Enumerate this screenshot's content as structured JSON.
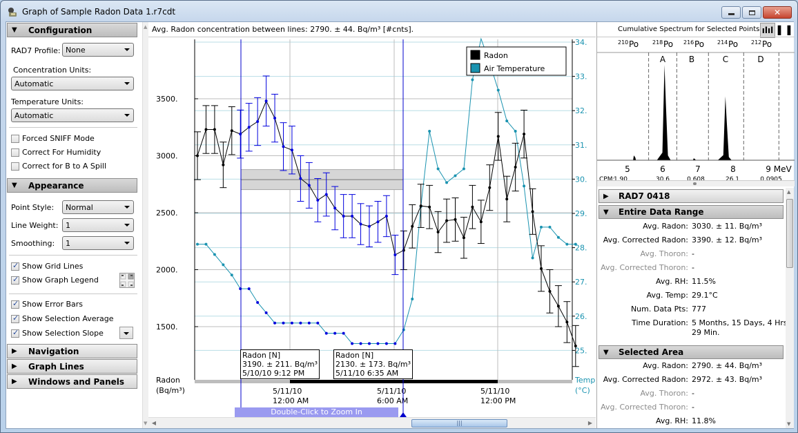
{
  "window": {
    "title": "Graph of Sample Radon Data 1.r7cdt",
    "minimize_label": "minimize",
    "maximize_label": "maximize",
    "close_label": "close"
  },
  "left_panel": {
    "configuration": {
      "header": "Configuration",
      "rad7_profile_label": "RAD7 Profile:",
      "rad7_profile_value": "None",
      "concentration_units_label": "Concentration Units:",
      "concentration_units_value": "Automatic",
      "temperature_units_label": "Temperature Units:",
      "temperature_units_value": "Automatic",
      "checkboxes": [
        {
          "label": "Forced SNIFF Mode",
          "checked": false
        },
        {
          "label": "Correct For Humidity",
          "checked": false
        },
        {
          "label": "Correct for B to A Spill",
          "checked": false
        }
      ]
    },
    "appearance": {
      "header": "Appearance",
      "point_style_label": "Point Style:",
      "point_style_value": "Normal",
      "line_weight_label": "Line Weight:",
      "line_weight_value": "1",
      "smoothing_label": "Smoothing:",
      "smoothing_value": "1",
      "checkboxes": [
        {
          "label": "Show Grid Lines",
          "checked": true
        },
        {
          "label": "Show Graph Legend",
          "checked": true
        },
        {
          "label": "Show Error Bars",
          "checked": true
        },
        {
          "label": "Show Selection Average",
          "checked": true
        },
        {
          "label": "Show Selection Slope",
          "checked": true
        }
      ]
    },
    "collapsed_sections": [
      "Navigation",
      "Graph Lines",
      "Windows and Panels"
    ]
  },
  "center": {
    "info_line": "Avg. Radon concentration between lines: 2790. ± 44. Bq/m³ [#cnts].",
    "zoom_hint": "Double-Click to Zoom In",
    "tooltips": [
      {
        "line1": "Radon [N]",
        "line2": "3190. ± 211. Bq/m³",
        "line3": "5/10/10 9:12 PM"
      },
      {
        "line1": "Radon [N]",
        "line2": "2130. ± 173. Bq/m³",
        "line3": "5/11/10 6:35 AM"
      }
    ]
  },
  "chart_data": {
    "type": "line",
    "title": "",
    "left_axis": {
      "label_line1": "Radon",
      "label_line2": "(Bq/m³)",
      "ticks": [
        1500,
        2000,
        2500,
        3000,
        3500
      ],
      "tick_labels": [
        "1500.",
        "2000.",
        "2500.",
        "3000.",
        "3500."
      ],
      "range": [
        1050,
        4040
      ]
    },
    "right_axis": {
      "label_line1": "Temp",
      "label_line2": "(°C)",
      "ticks": [
        25,
        26,
        27,
        28,
        29,
        30,
        31,
        32,
        33,
        34
      ],
      "tick_labels": [
        "25.",
        "26.",
        "27.",
        "28.",
        "29.",
        "30.",
        "31.",
        "32.",
        "33.",
        "34."
      ],
      "range": [
        24.1,
        34.1
      ],
      "color": "#1a93b0"
    },
    "x_tick_labels": [
      {
        "line1": "5/11/10",
        "line2": "12:00 AM"
      },
      {
        "line1": "5/11/10",
        "line2": "6:00 AM"
      },
      {
        "line1": "5/11/10",
        "line2": "12:00 PM"
      }
    ],
    "legend": {
      "position": "top-right",
      "entries": [
        {
          "name": "Radon",
          "color": "#000000"
        },
        {
          "name": "Air Temperature",
          "color": "#1a93b0"
        }
      ]
    },
    "selection": {
      "start_index": 5,
      "end_index": 24,
      "average": 2790,
      "average_uncertainty": 44,
      "line_color": "#0000cc"
    },
    "grid": true,
    "series": [
      {
        "name": "Radon",
        "color": "#000000",
        "selected_color": "#0000dd",
        "values": [
          3000,
          3230,
          3230,
          2920,
          3220,
          3190,
          3250,
          3300,
          3480,
          3330,
          3080,
          3050,
          2800,
          2740,
          2610,
          2660,
          2540,
          2470,
          2470,
          2400,
          2380,
          2420,
          2470,
          2130,
          2170,
          2380,
          2560,
          2550,
          2330,
          2430,
          2440,
          2280,
          2550,
          2420,
          2720,
          3170,
          2620,
          2900,
          3190,
          2510,
          2010,
          1810,
          1680,
          1540,
          1330
        ],
        "errors": [
          210,
          210,
          210,
          200,
          210,
          211,
          210,
          210,
          220,
          210,
          210,
          210,
          200,
          200,
          190,
          190,
          190,
          190,
          190,
          180,
          180,
          180,
          180,
          173,
          170,
          190,
          190,
          190,
          180,
          190,
          190,
          180,
          190,
          190,
          200,
          210,
          200,
          210,
          210,
          200,
          200,
          190,
          180,
          180,
          180
        ]
      },
      {
        "name": "Air Temperature",
        "color": "#1a93b0",
        "selected_color": "#0000dd",
        "x_index": [
          0,
          1,
          2,
          3,
          4,
          5,
          6,
          7,
          8,
          9,
          10,
          11,
          12,
          13,
          14,
          15,
          16,
          17,
          18,
          19,
          20,
          21,
          22,
          23,
          24,
          25,
          26,
          27,
          28,
          29,
          30,
          31,
          32,
          33,
          34,
          35,
          36,
          37,
          38,
          39,
          40,
          41,
          42,
          43,
          44
        ],
        "values": [
          28.1,
          28.1,
          27.8,
          27.5,
          27.2,
          26.8,
          26.8,
          26.4,
          26.1,
          25.8,
          25.8,
          25.8,
          25.8,
          25.8,
          25.8,
          25.5,
          25.5,
          25.5,
          25.2,
          25.2,
          25.2,
          25.2,
          25.2,
          25.2,
          25.6,
          26.5,
          29.2,
          31.4,
          30.3,
          29.9,
          30.1,
          30.3,
          32.9,
          34.4,
          33.4,
          32.6,
          31.7,
          31.4,
          29.8,
          27.7,
          28.6,
          28.6,
          28.3,
          28.1,
          28.1
        ]
      }
    ]
  },
  "right_panel": {
    "spectrum_title": "Cumulative Spectrum for Selected Points",
    "isotopes": [
      {
        "mass": "210",
        "symbol": "Po"
      },
      {
        "mass": "218",
        "symbol": "Po"
      },
      {
        "mass": "216",
        "symbol": "Po"
      },
      {
        "mass": "214",
        "symbol": "Po"
      },
      {
        "mass": "212",
        "symbol": "Po"
      }
    ],
    "windows": [
      "A",
      "B",
      "C",
      "D"
    ],
    "energy_ticks": [
      "5",
      "6",
      "7",
      "8",
      "9 MeV"
    ],
    "cpm_label": "CPM:",
    "cpm_values": [
      "1.90",
      "30.6",
      "0.608",
      "26.1",
      "0.0905"
    ],
    "spectrum_peaks": [
      {
        "energy_mev": 5.2,
        "relative_height": 0.05
      },
      {
        "energy_mev": 6.07,
        "relative_height": 1.0
      },
      {
        "energy_mev": 6.9,
        "relative_height": 0.02
      },
      {
        "energy_mev": 7.8,
        "relative_height": 0.67
      }
    ],
    "device_header": "RAD7 0418",
    "entire_range": {
      "header": "Entire Data Range",
      "rows": [
        {
          "key": "Avg. Radon:",
          "value": "3030. ± 11. Bq/m³",
          "dim": false
        },
        {
          "key": "Avg. Corrected Radon:",
          "value": "3390. ± 12. Bq/m³",
          "dim": false
        },
        {
          "key": "Avg. Thoron:",
          "value": "-",
          "dim": true
        },
        {
          "key": "Avg. Corrected Thoron:",
          "value": "-",
          "dim": true
        },
        {
          "key": "Avg. RH:",
          "value": "11.5%",
          "dim": false
        },
        {
          "key": "Avg. Temp:",
          "value": "29.1°C",
          "dim": false
        },
        {
          "key": "Num. Data Pts:",
          "value": "777",
          "dim": false
        },
        {
          "key": "Time Duration:",
          "value": "5 Months, 15 Days, 4 Hrs.,",
          "value2": "29 Min.",
          "dim": false
        }
      ]
    },
    "selected_area": {
      "header": "Selected Area",
      "rows": [
        {
          "key": "Avg. Radon:",
          "value": "2790. ± 44. Bq/m³",
          "dim": false
        },
        {
          "key": "Avg. Corrected Radon:",
          "value": "2972. ± 43. Bq/m³",
          "dim": false
        },
        {
          "key": "Avg. Thoron:",
          "value": "-",
          "dim": true
        },
        {
          "key": "Avg. Corrected Thoron:",
          "value": "-",
          "dim": true
        },
        {
          "key": "Avg. RH:",
          "value": "11.8%",
          "dim": false
        }
      ]
    }
  }
}
